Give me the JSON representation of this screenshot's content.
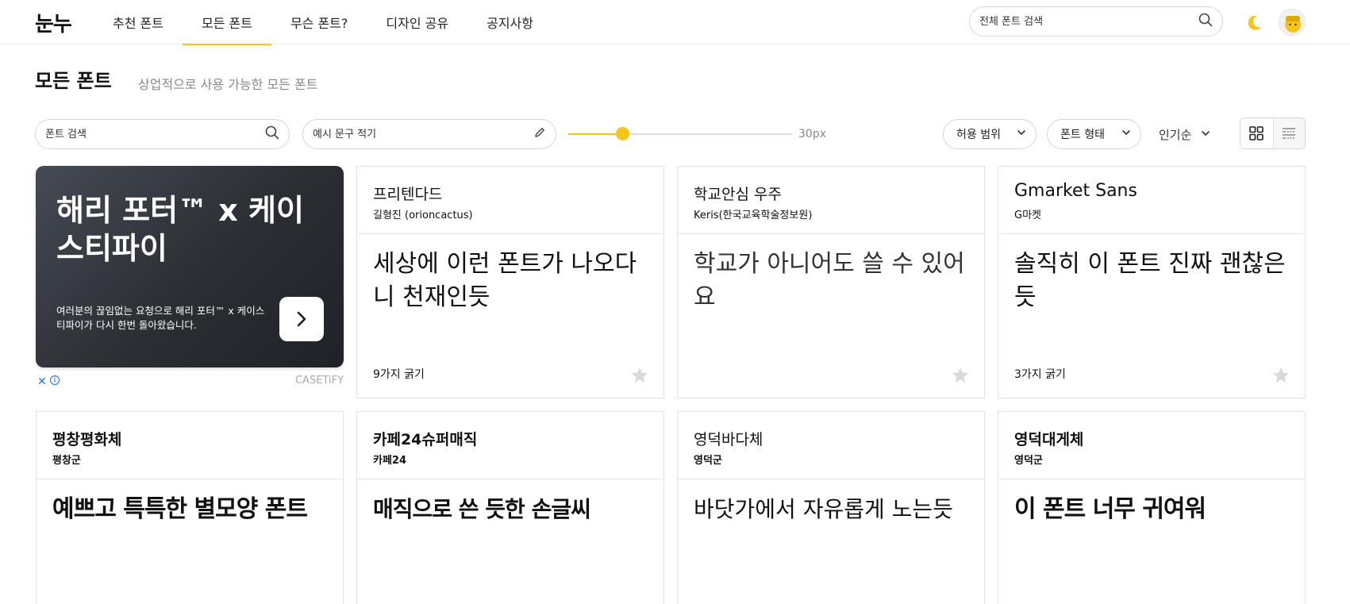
{
  "header": {
    "logo": "눈누",
    "nav": [
      {
        "label": "추천 폰트",
        "active": false
      },
      {
        "label": "모든 폰트",
        "active": true
      },
      {
        "label": "무슨 폰트?",
        "active": false
      },
      {
        "label": "디자인 공유",
        "active": false
      },
      {
        "label": "공지사항",
        "active": false
      }
    ],
    "search_placeholder": "전체 폰트 검색",
    "icons": {
      "search": "search-icon",
      "theme": "moon-icon",
      "avatar": "avatar"
    }
  },
  "page": {
    "title": "모든 폰트",
    "subtitle": "상업적으로 사용 가능한 모든 폰트"
  },
  "controls": {
    "font_search_placeholder": "폰트 검색",
    "sample_text_placeholder": "예시 문구 적기",
    "size_label": "30px",
    "size_value_fraction": 0.24,
    "license_dropdown": "허용 범위",
    "type_dropdown": "폰트 형태",
    "sort_label": "인기순",
    "view_mode": "grid"
  },
  "ad": {
    "headline": "해리 포터™ x 케이스티파이",
    "description": "여러분의 끊임없는 요청으로 해리 포터™ x 케이스티파이가 다시 한번 돌아왔습니다.",
    "close_label": "✕",
    "info_label": "i",
    "brand": "CASETiFY"
  },
  "cards": [
    {
      "name": "프리텐다드",
      "maker": "길형진 (orioncactus)",
      "sample": "세상에 이런 폰트가 나오다니 천재인듯",
      "weights": "9가지 굵기"
    },
    {
      "name": "학교안심 우주",
      "maker": "Keris(한국교육학술정보원)",
      "sample": "학교가 아니어도 쓸 수 있어요",
      "weights": ""
    },
    {
      "name": "Gmarket Sans",
      "maker": "G마켓",
      "sample": "솔직히 이 폰트 진짜 괜찮은듯",
      "weights": "3가지 굵기"
    },
    {
      "name": "평창평화체",
      "maker": "평창군",
      "sample": "예쁘고 특특한 별모양 폰트",
      "weights": ""
    },
    {
      "name": "카페24슈퍼매직",
      "maker": "카페24",
      "sample": "매직으로 쓴 듯한 손글씨",
      "weights": ""
    },
    {
      "name": "영덕바다체",
      "maker": "영덕군",
      "sample": "바닷가에서 자유롭게 노는듯",
      "weights": ""
    },
    {
      "name": "영덕대게체",
      "maker": "영덕군",
      "sample": "이 폰트 너무 귀여워",
      "weights": ""
    }
  ],
  "colors": {
    "accent": "#f5c518",
    "border": "#e2e2e2",
    "muted_text": "#888888",
    "ad_bg": "#2b2e33"
  }
}
